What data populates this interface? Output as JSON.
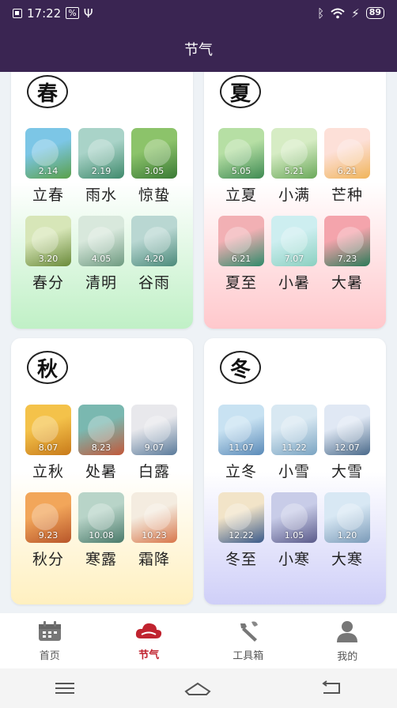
{
  "status": {
    "time": "17:22",
    "battery": "89"
  },
  "header": {
    "title": "节气"
  },
  "seasons": [
    {
      "name": "春",
      "terms": [
        {
          "name": "立春",
          "date": "2.14",
          "colors": [
            "#7cc6e6",
            "#5aa04a"
          ]
        },
        {
          "name": "雨水",
          "date": "2.19",
          "colors": [
            "#a9d3c8",
            "#3f8a6c"
          ]
        },
        {
          "name": "惊蛰",
          "date": "3.05",
          "colors": [
            "#8cc36a",
            "#3a7a35"
          ]
        },
        {
          "name": "春分",
          "date": "3.20",
          "colors": [
            "#d7e6b8",
            "#6a8a3a"
          ]
        },
        {
          "name": "清明",
          "date": "4.05",
          "colors": [
            "#d8e8dc",
            "#6e9a80"
          ]
        },
        {
          "name": "谷雨",
          "date": "4.20",
          "colors": [
            "#b9d7d2",
            "#4b8a7a"
          ]
        }
      ]
    },
    {
      "name": "夏",
      "terms": [
        {
          "name": "立夏",
          "date": "5.05",
          "colors": [
            "#b6dfa4",
            "#3e8a52"
          ]
        },
        {
          "name": "小满",
          "date": "5.21",
          "colors": [
            "#d6ecc4",
            "#6aa85a"
          ]
        },
        {
          "name": "芒种",
          "date": "6.21",
          "colors": [
            "#fde0d8",
            "#f0b45a"
          ]
        },
        {
          "name": "夏至",
          "date": "6.21",
          "colors": [
            "#f2b0b4",
            "#2f8a6a"
          ]
        },
        {
          "name": "小暑",
          "date": "7.07",
          "colors": [
            "#cdeef0",
            "#8ad0c0"
          ]
        },
        {
          "name": "大暑",
          "date": "7.23",
          "colors": [
            "#f4a4ac",
            "#2c7a58"
          ]
        }
      ]
    },
    {
      "name": "秋",
      "terms": [
        {
          "name": "立秋",
          "date": "8.07",
          "colors": [
            "#f4c24a",
            "#c87a1a"
          ]
        },
        {
          "name": "处暑",
          "date": "8.23",
          "colors": [
            "#7ab8b0",
            "#c2583a"
          ]
        },
        {
          "name": "白露",
          "date": "9.07",
          "colors": [
            "#e8e8ec",
            "#5a7a9a"
          ]
        },
        {
          "name": "秋分",
          "date": "9.23",
          "colors": [
            "#f2a65a",
            "#b8562a"
          ]
        },
        {
          "name": "寒露",
          "date": "10.08",
          "colors": [
            "#b8d4c8",
            "#4a7a6a"
          ]
        },
        {
          "name": "霜降",
          "date": "10.23",
          "colors": [
            "#f4ece0",
            "#d8764a"
          ]
        }
      ]
    },
    {
      "name": "冬",
      "terms": [
        {
          "name": "立冬",
          "date": "11.07",
          "colors": [
            "#c8e2f2",
            "#5a8ab8"
          ]
        },
        {
          "name": "小雪",
          "date": "11.22",
          "colors": [
            "#d8e8f2",
            "#7aa4c2"
          ]
        },
        {
          "name": "大雪",
          "date": "12.07",
          "colors": [
            "#e0e8f4",
            "#4a6a8a"
          ]
        },
        {
          "name": "冬至",
          "date": "12.22",
          "colors": [
            "#f2e4c8",
            "#3a5a8a"
          ]
        },
        {
          "name": "小寒",
          "date": "1.05",
          "colors": [
            "#c8cce8",
            "#5a5a8a"
          ]
        },
        {
          "name": "大寒",
          "date": "1.20",
          "colors": [
            "#d8e8f4",
            "#7a9ab8"
          ]
        }
      ]
    }
  ],
  "tabs": [
    {
      "label": "首页",
      "icon": "calendar-icon"
    },
    {
      "label": "节气",
      "icon": "cloud-icon"
    },
    {
      "label": "工具箱",
      "icon": "wrench-icon"
    },
    {
      "label": "我的",
      "icon": "person-icon"
    }
  ],
  "colors": {
    "accent": "#c0232f",
    "header": "#3a2552",
    "tab_inactive": "#666666"
  }
}
